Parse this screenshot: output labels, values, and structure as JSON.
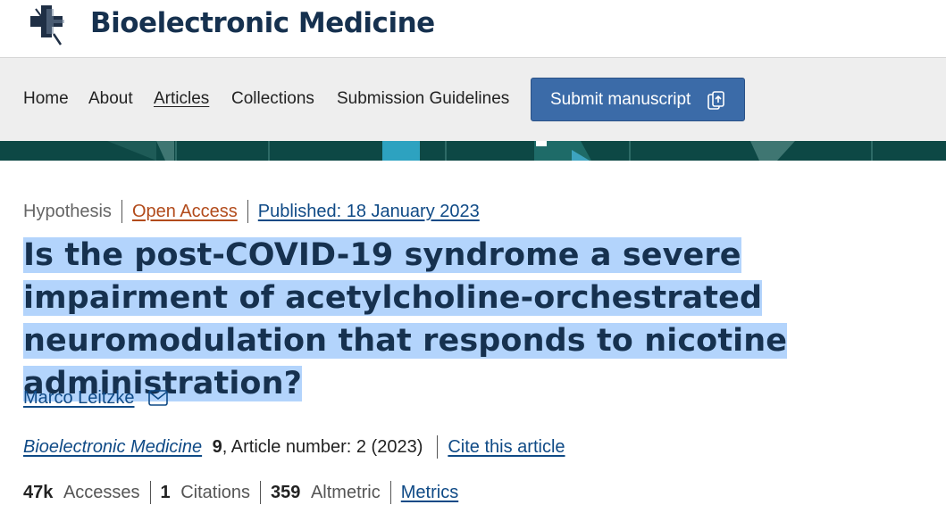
{
  "header": {
    "site_title": "Bioelectronic Medicine",
    "logo_icon": "cross-logo-icon"
  },
  "nav": {
    "items": [
      {
        "label": "Home",
        "active": false
      },
      {
        "label": "About",
        "active": false
      },
      {
        "label": "Articles",
        "active": true
      },
      {
        "label": "Collections",
        "active": false
      },
      {
        "label": "Submission Guidelines",
        "active": false
      }
    ],
    "submit_label": "Submit manuscript",
    "submit_icon": "external-submit-icon"
  },
  "article": {
    "type": "Hypothesis",
    "access": "Open Access",
    "published": "Published: 18 January 2023",
    "title": "Is the post-COVID-19 syndrome a severe impairment of acetylcholine-orchestrated neuromodulation that responds to nicotine administration?",
    "author": "Marco Leitzke",
    "author_icon": "envelope-icon",
    "journal": "Bioelectronic Medicine",
    "volume": "9",
    "article_number": ", Article number: 2 (2023)",
    "cite_label": "Cite this article",
    "metrics": {
      "accesses_value": "47k",
      "accesses_label": "Accesses",
      "citations_value": "1",
      "citations_label": "Citations",
      "altmetric_value": "359",
      "altmetric_label": "Altmetric",
      "metrics_link": "Metrics"
    }
  },
  "colors": {
    "title": "#16314f",
    "link": "#0f4a86",
    "open_access": "#b24b1b",
    "button": "#3b6ba8",
    "banner": "#0d4845",
    "selection": "#b3d4fc",
    "nav_bg": "#eeeeee"
  }
}
